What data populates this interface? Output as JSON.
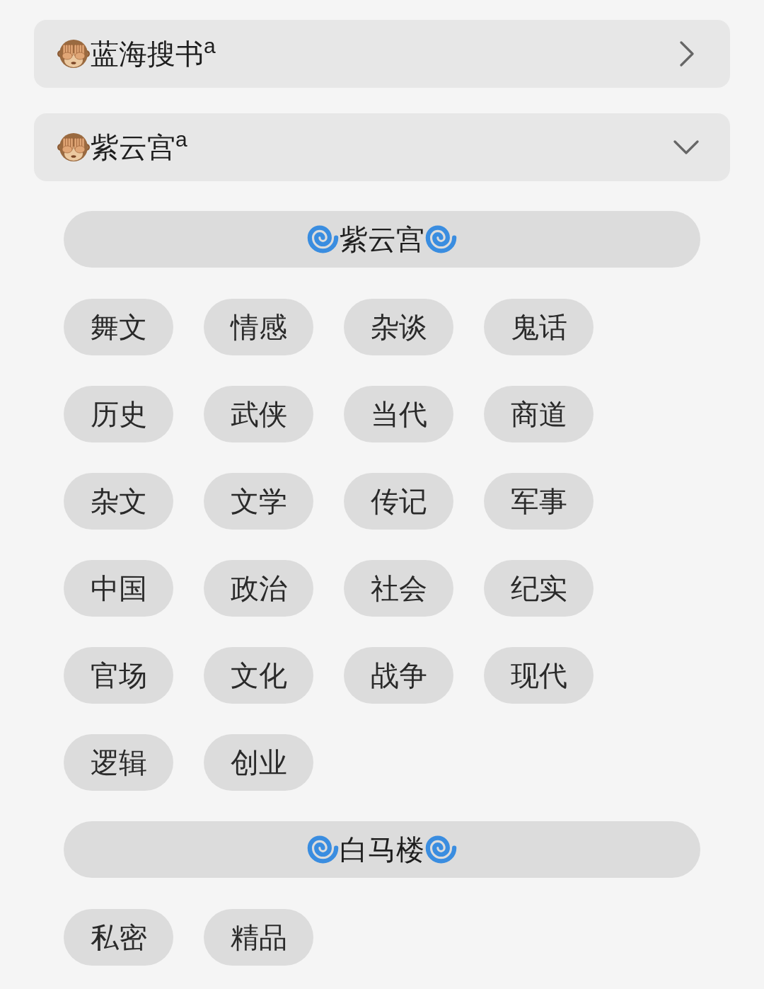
{
  "panels": [
    {
      "title": "蓝海搜书$^{a}$",
      "expanded": false
    },
    {
      "title": "紫云宫$^{a}$",
      "expanded": true,
      "groups": [
        {
          "title": "紫云宫",
          "tags": [
            "舞文",
            "情感",
            "杂谈",
            "鬼话",
            "历史",
            "武侠",
            "当代",
            "商道",
            "杂文",
            "文学",
            "传记",
            "军事",
            "中国",
            "政治",
            "社会",
            "纪实",
            "官场",
            "文化",
            "战争",
            "现代",
            "逻辑",
            "创业"
          ]
        },
        {
          "title": "白马楼",
          "tags": [
            "私密",
            "精品"
          ]
        }
      ]
    }
  ]
}
